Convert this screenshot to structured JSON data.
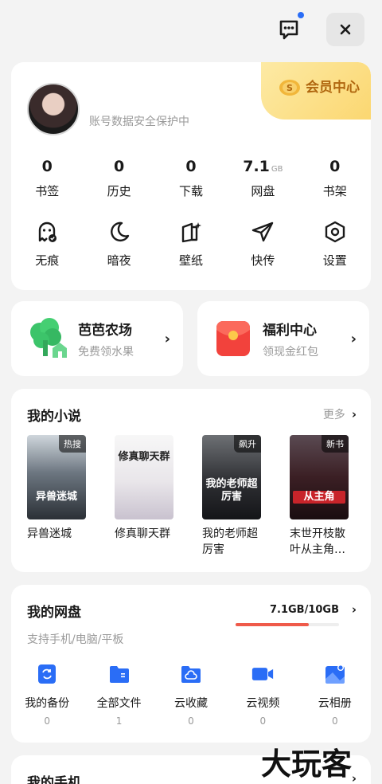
{
  "header": {
    "message_icon": "chat-bubble-icon",
    "close_icon": "close-icon"
  },
  "profile": {
    "vip_label": "会员中心",
    "account_hint": "账号数据安全保护中",
    "stats": [
      {
        "value": "0",
        "unit": "",
        "label": "书签"
      },
      {
        "value": "0",
        "unit": "",
        "label": "历史"
      },
      {
        "value": "0",
        "unit": "",
        "label": "下载"
      },
      {
        "value": "7.1",
        "unit": "GB",
        "label": "网盘"
      },
      {
        "value": "0",
        "unit": "",
        "label": "书架"
      }
    ],
    "tools": [
      {
        "label": "无痕",
        "icon": "ghost-icon"
      },
      {
        "label": "暗夜",
        "icon": "moon-icon"
      },
      {
        "label": "壁纸",
        "icon": "wallpaper-icon"
      },
      {
        "label": "快传",
        "icon": "paper-plane-icon"
      },
      {
        "label": "设置",
        "icon": "settings-icon"
      }
    ]
  },
  "promos": [
    {
      "title": "芭芭农场",
      "subtitle": "免费领水果",
      "icon": "tree-icon"
    },
    {
      "title": "福利中心",
      "subtitle": "领现金红包",
      "icon": "red-envelope-icon"
    }
  ],
  "novels": {
    "title": "我的小说",
    "more_label": "更多",
    "books": [
      {
        "name": "异兽迷城",
        "badge": "热搜",
        "cover_text": "异兽迷城"
      },
      {
        "name": "修真聊天群",
        "badge": "",
        "cover_text": "修真聊天群"
      },
      {
        "name": "我的老师超厉害",
        "badge": "飙升",
        "cover_text": "我的老师超厉害"
      },
      {
        "name": "末世开枝散叶从主角…",
        "badge": "新书",
        "cover_text": "从主角"
      }
    ]
  },
  "disk": {
    "title": "我的网盘",
    "usage": "7.1GB/10GB",
    "used_fraction": 0.71,
    "subtitle": "支持手机/电脑/平板",
    "items": [
      {
        "label": "我的备份",
        "count": "0",
        "icon": "backup-icon"
      },
      {
        "label": "全部文件",
        "count": "1",
        "icon": "folder-icon"
      },
      {
        "label": "云收藏",
        "count": "0",
        "icon": "cloud-folder-icon"
      },
      {
        "label": "云视频",
        "count": "0",
        "icon": "video-icon"
      },
      {
        "label": "云相册",
        "count": "0",
        "icon": "photo-icon"
      }
    ]
  },
  "phone": {
    "title": "我的手机"
  },
  "watermark": "大玩客",
  "colors": {
    "accent_blue": "#2a6df6",
    "vip_gold": "#fbd771",
    "progress_red": "#ef5a4a"
  }
}
